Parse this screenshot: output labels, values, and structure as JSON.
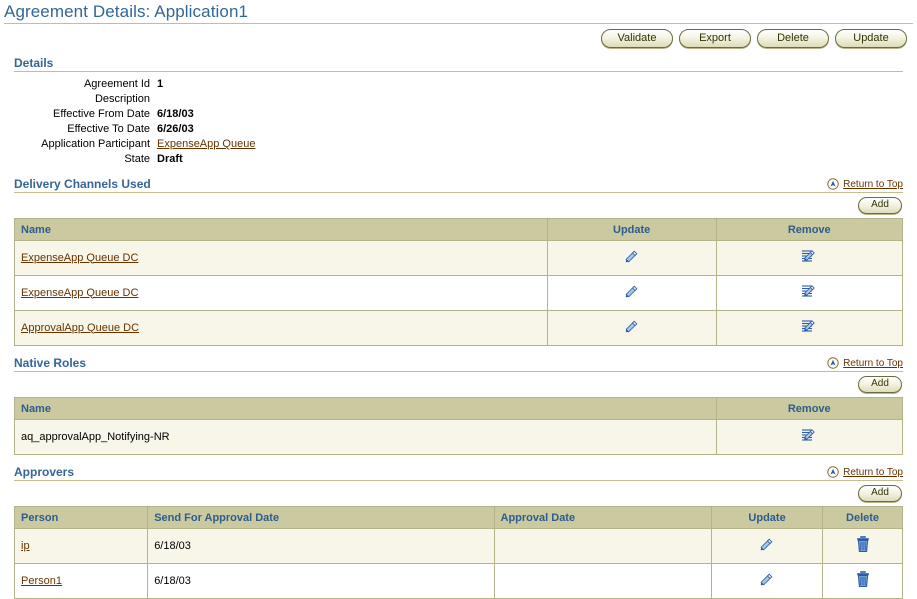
{
  "page": {
    "title": "Agreement Details: Application1"
  },
  "toolbar": {
    "buttons": [
      {
        "label": "Validate",
        "name": "validate-button"
      },
      {
        "label": "Export",
        "name": "export-button"
      },
      {
        "label": "Delete",
        "name": "delete-button"
      },
      {
        "label": "Update",
        "name": "update-button"
      }
    ]
  },
  "details": {
    "title": "Details",
    "fields": [
      {
        "label": "Agreement Id",
        "value": "1",
        "link": false
      },
      {
        "label": "Description",
        "value": "",
        "link": false
      },
      {
        "label": "Effective From Date",
        "value": "6/18/03",
        "link": false
      },
      {
        "label": "Effective To Date",
        "value": "6/26/03",
        "link": false
      },
      {
        "label": "Application Participant",
        "value": "ExpenseApp Queue",
        "link": true
      },
      {
        "label": "State",
        "value": "Draft",
        "link": false
      }
    ]
  },
  "return_to_top": {
    "label": "Return to Top",
    "icon": "circled-up-arrow-icon"
  },
  "add_button": {
    "label": "Add"
  },
  "delivery_channels": {
    "title": "Delivery Channels Used",
    "columns": [
      "Name",
      "Update",
      "Remove"
    ],
    "rows": [
      {
        "name": "ExpenseApp Queue DC",
        "update_icon": "pencil-icon",
        "remove_icon": "edit-document-icon"
      },
      {
        "name": "ExpenseApp Queue DC",
        "update_icon": "pencil-icon",
        "remove_icon": "edit-document-icon"
      },
      {
        "name": "ApprovalApp Queue DC",
        "update_icon": "pencil-icon",
        "remove_icon": "edit-document-icon"
      }
    ]
  },
  "native_roles": {
    "title": "Native Roles",
    "columns": [
      "Name",
      "Remove"
    ],
    "rows": [
      {
        "name": "aq_approvalApp_Notifying-NR",
        "remove_icon": "edit-document-icon"
      }
    ]
  },
  "approvers": {
    "title": "Approvers",
    "columns": [
      "Person",
      "Send For Approval Date",
      "Approval Date",
      "Update",
      "Delete"
    ],
    "rows": [
      {
        "person": "ip",
        "send_for_approval_date": "6/18/03",
        "approval_date": "",
        "update_icon": "pencil-icon",
        "delete_icon": "trash-icon"
      },
      {
        "person": "Person1",
        "send_for_approval_date": "6/18/03",
        "approval_date": "",
        "update_icon": "pencil-icon",
        "delete_icon": "trash-icon"
      }
    ]
  },
  "colors": {
    "header_blue": "#336699",
    "rule_olive": "#c3c08f",
    "table_header_bg": "#cbc9a0",
    "row_alt_bg": "#f7f6e8",
    "link_brown": "#663300",
    "icon_blue": "#2a5caa"
  }
}
